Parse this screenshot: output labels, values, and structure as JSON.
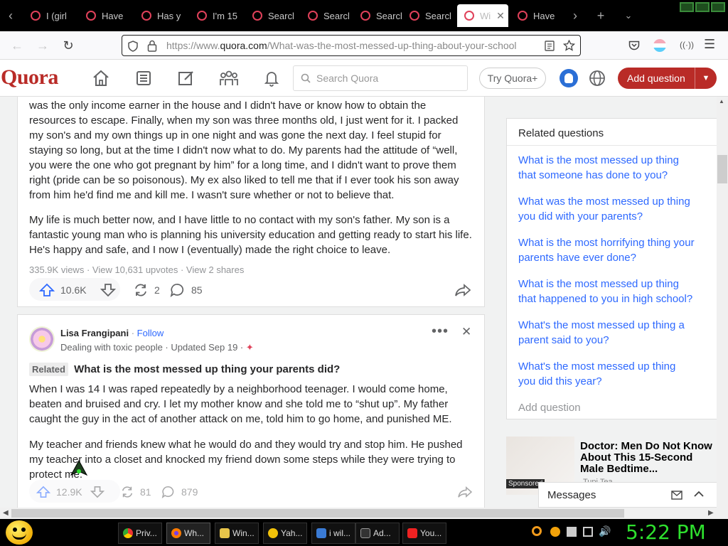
{
  "browser": {
    "tabs": [
      {
        "label": "I (girl"
      },
      {
        "label": "Have"
      },
      {
        "label": "Has y"
      },
      {
        "label": "I'm 15"
      },
      {
        "label": "Searcl"
      },
      {
        "label": "Searcl"
      },
      {
        "label": "Searcl"
      },
      {
        "label": "Searcl"
      },
      {
        "label": "Wi"
      },
      {
        "label": "Have"
      }
    ],
    "url_prefix": "https://www.",
    "url_domain": "quora.com",
    "url_path": "/What-was-the-most-messed-up-thing-about-your-school"
  },
  "quora": {
    "logo": "Quora",
    "search_placeholder": "Search Quora",
    "try_button": "Try Quora+",
    "add_question": "Add question"
  },
  "answer1": {
    "para1": "was the only income earner in the house and I didn't have or know how to obtain the resources to escape. Finally, when my son was three months old, I just went for it. I packed my son's and my own things up in one night and was gone the next day. I feel stupid for staying so long, but at the time I didn't now what to do. My parents had the attitude of “well, you were the one who got pregnant by him” for a long time, and I didn't want to prove them right (pride can be so poisonous). My ex also liked to tell me that if I ever took his son away from him he'd find me and kill me. I wasn't sure whether or not to believe that.",
    "para2": "My life is much better now, and I have little to no contact with my son's father. My son is a fantastic young man who is planning his university education and getting ready to start his life. He's happy and safe, and I now I (eventually) made the right choice to leave.",
    "views": "335.9K views",
    "upvotes_link": "View 10,631 upvotes",
    "shares_link": "View 2 shares",
    "upvote_count": "10.6K",
    "share_count": "2",
    "comment_count": "85"
  },
  "answer2": {
    "author": "Lisa Frangipani",
    "follow": "Follow",
    "credential": "Dealing with toxic people · Updated Sep 19 ·",
    "related_tag": "Related",
    "question": "What is the most messed up thing your parents did?",
    "para1": "When I was 14 I was raped repeatedly by a neighborhood teenager. I would come home, beaten and bruised and cry. I let my mother know and she told me to “shut up”. My father caught the guy in the act of another attack on me, told him to go home, and punished ME.",
    "para2": "My teacher and friends knew what he would do and they would try and stop him. He pushed my teacher into a closet and knocked my friend down some steps while they were trying to protect me.",
    "upvote_count": "12.9K",
    "share_count": "81",
    "comment_count": "879"
  },
  "sidebar": {
    "title": "Related questions",
    "items": [
      "What is the most messed up thing that someone has done to you?",
      "What was the most messed up thing you did with your parents?",
      "What is the most horrifying thing your parents have ever done?",
      "What is the most messed up thing that happened to you in high school?",
      "What's the most messed up thing a parent said to you?",
      "What's the most messed up thing you did this year?"
    ],
    "add_question": "Add question"
  },
  "ad": {
    "headline": "Doctor: Men Do Not Know About This 15-Second Male Bedtime...",
    "source": "Tupi Tea",
    "sponsored": "Sponsored"
  },
  "messages": {
    "label": "Messages"
  },
  "taskbar": {
    "items": [
      "Priv...",
      "Wh...",
      "Win...",
      "Yah...",
      "i wil...",
      "Ad...",
      "You..."
    ],
    "clock": "5:22 PM"
  },
  "colors": {
    "brand": "#b92b27",
    "link": "#2e69ff",
    "clock": "#2ee02e"
  }
}
